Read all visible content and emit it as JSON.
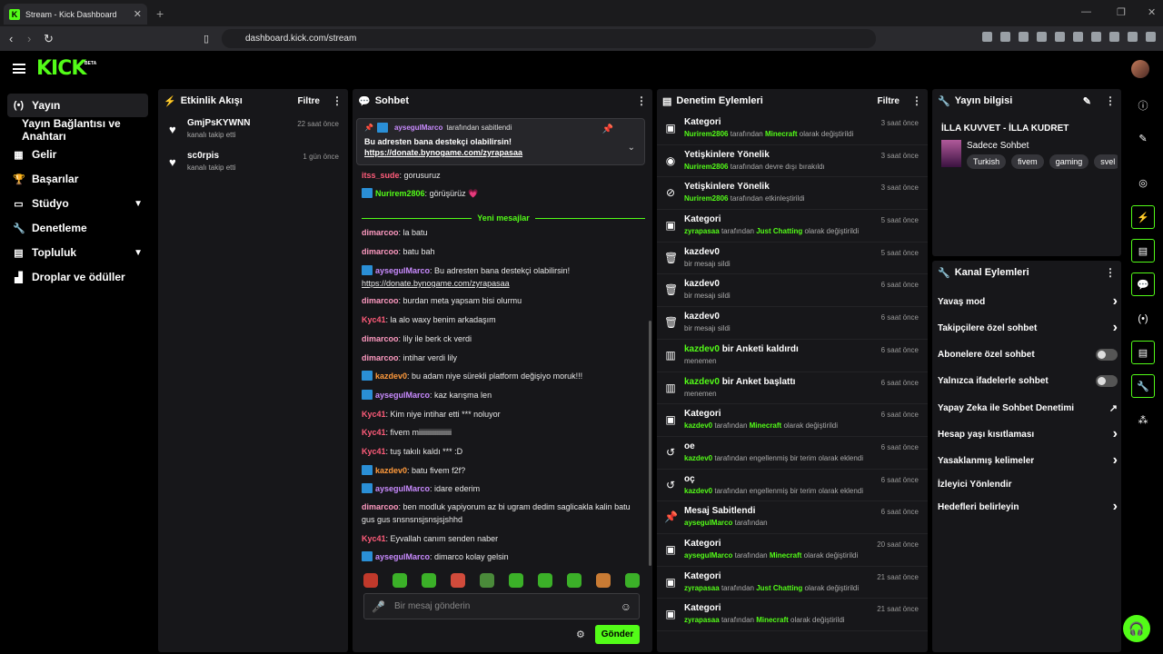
{
  "browser": {
    "tab_title": "Stream - Kick Dashboard",
    "url": "dashboard.kick.com/stream"
  },
  "header": {
    "logo": "KICK",
    "beta": "BETA"
  },
  "sidebar": {
    "items": [
      {
        "label": "Yayın",
        "icon": "broadcast-icon"
      },
      {
        "label": "Yayın Bağlantısı ve Anahtarı",
        "icon": ""
      },
      {
        "label": "Gelir",
        "icon": "grid-icon"
      },
      {
        "label": "Başarılar",
        "icon": "trophy-icon"
      },
      {
        "label": "Stüdyo",
        "icon": "studio-icon"
      },
      {
        "label": "Denetleme",
        "icon": "wrench-icon"
      },
      {
        "label": "Topluluk",
        "icon": "community-icon"
      },
      {
        "label": "Droplar ve ödüller",
        "icon": "drops-icon"
      }
    ]
  },
  "activity": {
    "title": "Etkinlik Akışı",
    "filter": "Filtre",
    "items": [
      {
        "name": "GmjPsKYWNN",
        "sub": "kanalı takip etti",
        "time": "22 saat önce"
      },
      {
        "name": "sc0rpis",
        "sub": "kanalı takip etti",
        "time": "1 gün önce"
      }
    ]
  },
  "chat": {
    "title": "Sohbet",
    "pinned": {
      "user": "aysegulMarco",
      "by": "tarafından sabitlendi",
      "message": "Bu adresten bana destekçi olabilirsin!",
      "link": "https://donate.bynogame.com/zyrapasaa"
    },
    "new_messages": "Yeni mesajlar",
    "messages": [
      {
        "user": "itss_sude",
        "color": "#ff5c7a",
        "text": "gorusuruz",
        "badge": false
      },
      {
        "user": "Nurirem2806",
        "color": "#53fc18",
        "text": "görüşürüz 💗",
        "badge": true
      },
      {
        "user": "dimarcoo",
        "color": "#ff9ac1",
        "text": "la batu",
        "badge": false
      },
      {
        "user": "dimarcoo",
        "color": "#ff9ac1",
        "text": "batu bah",
        "badge": false
      },
      {
        "user": "aysegulMarco",
        "color": "#c98bff",
        "text": "Bu adresten bana destekçi olabilirsin!",
        "link": "https://donate.bynogame.com/zyrapasaa",
        "badge": true
      },
      {
        "user": "dimarcoo",
        "color": "#ff9ac1",
        "text": "burdan meta yapsam bisi olurmu",
        "badge": false
      },
      {
        "user": "Kyc41",
        "color": "#ff5c7a",
        "text": "la alo waxy benim arkadaşım",
        "badge": false
      },
      {
        "user": "dimarcoo",
        "color": "#ff9ac1",
        "text": "lily ile berk ck verdi",
        "badge": false
      },
      {
        "user": "dimarcoo",
        "color": "#ff9ac1",
        "text": "intihar verdi lily",
        "badge": false
      },
      {
        "user": "kazdev0",
        "color": "#ff9a3c",
        "text": "bu adam niye sürekli platform değişiyo moruk!!!",
        "badge": true
      },
      {
        "user": "aysegulMarco",
        "color": "#c98bff",
        "text": "kaz karışma len",
        "badge": true
      },
      {
        "user": "Kyc41",
        "color": "#ff5c7a",
        "text": "Kim niye intihar etti *** noluyor",
        "badge": false
      },
      {
        "user": "Kyc41",
        "color": "#ff5c7a",
        "text": "fivem miiiiiiiiiiiiiiiiii",
        "badge": false
      },
      {
        "user": "Kyc41",
        "color": "#ff5c7a",
        "text": "tuş takılı kaldı *** :D",
        "badge": false
      },
      {
        "user": "kazdev0",
        "color": "#ff9a3c",
        "text": "batu fivem f2f?",
        "badge": true
      },
      {
        "user": "aysegulMarco",
        "color": "#c98bff",
        "text": "idare ederim",
        "badge": true
      },
      {
        "user": "dimarcoo",
        "color": "#ff9ac1",
        "text": "ben modluk yapiyorum az bi ugram dedim saglicakla kalin batu gus gus snsnsnsjsnsjsjshhd",
        "badge": false
      },
      {
        "user": "Kyc41",
        "color": "#ff5c7a",
        "text": "Eyvallah canım senden naber",
        "badge": false
      },
      {
        "user": "aysegulMarco",
        "color": "#c98bff",
        "text": "dimarco kolay gelsin",
        "badge": true
      }
    ],
    "input_placeholder": "Bir mesaj gönderin",
    "send": "Gönder"
  },
  "moderation": {
    "title": "Denetim Eylemleri",
    "filter": "Filtre",
    "items": [
      {
        "icon": "category-icon",
        "title": "Kategori",
        "by": "Nurirem2806",
        "mid": "tarafından",
        "val": "Minecraft",
        "end": "olarak değiştirildi",
        "time": "3 saat önce"
      },
      {
        "icon": "eye-icon",
        "title": "Yetişkinlere Yönelik",
        "by": "Nurirem2806",
        "mid": "tarafından devre dışı bırakıldı",
        "val": "",
        "end": "",
        "time": "3 saat önce"
      },
      {
        "icon": "eye-off-icon",
        "title": "Yetişkinlere Yönelik",
        "by": "Nurirem2806",
        "mid": "tarafından etkinleştirildi",
        "val": "",
        "end": "",
        "time": "3 saat önce"
      },
      {
        "icon": "category-icon",
        "title": "Kategori",
        "by": "zyrapasaa",
        "mid": "tarafından",
        "val": "Just Chatting",
        "end": "olarak değiştirildi",
        "time": "5 saat önce"
      },
      {
        "icon": "trash-icon",
        "title": "kazdev0",
        "by": "",
        "mid": "bir mesajı sildi",
        "val": "",
        "end": "",
        "time": "5 saat önce"
      },
      {
        "icon": "trash-icon",
        "title": "kazdev0",
        "by": "",
        "mid": "bir mesajı sildi",
        "val": "",
        "end": "",
        "time": "6 saat önce"
      },
      {
        "icon": "trash-icon",
        "title": "kazdev0",
        "by": "",
        "mid": "bir mesajı sildi",
        "val": "",
        "end": "",
        "time": "6 saat önce"
      },
      {
        "icon": "poll-icon",
        "title_g": "kazdev0",
        "title": "bir Anketi kaldırdı",
        "by": "",
        "mid": "menemen",
        "val": "",
        "end": "",
        "time": "6 saat önce"
      },
      {
        "icon": "poll-icon",
        "title_g": "kazdev0",
        "title": "bir Anket başlattı",
        "by": "",
        "mid": "menemen",
        "val": "",
        "end": "",
        "time": "6 saat önce"
      },
      {
        "icon": "category-icon",
        "title": "Kategori",
        "by": "kazdev0",
        "mid": "tarafından",
        "val": "Minecraft",
        "end": "olarak değiştirildi",
        "time": "6 saat önce"
      },
      {
        "icon": "undo-icon",
        "title": "oe",
        "by": "kazdev0",
        "mid": "tarafından engellenmiş bir terim olarak eklendi",
        "val": "",
        "end": "",
        "time": "6 saat önce"
      },
      {
        "icon": "undo-icon",
        "title": "oç",
        "by": "kazdev0",
        "mid": "tarafından engellenmiş bir terim olarak eklendi",
        "val": "",
        "end": "",
        "time": "6 saat önce"
      },
      {
        "icon": "pin-icon",
        "title": "Mesaj Sabitlendi",
        "by": "aysegulMarco",
        "mid": "tarafından",
        "val": "",
        "end": "",
        "time": "6 saat önce"
      },
      {
        "icon": "category-icon",
        "title": "Kategori",
        "by": "aysegulMarco",
        "mid": "tarafından",
        "val": "Minecraft",
        "end": "olarak değiştirildi",
        "time": "20 saat önce"
      },
      {
        "icon": "category-icon",
        "title": "Kategori",
        "by": "zyrapasaa",
        "mid": "tarafından",
        "val": "Just Chatting",
        "end": "olarak değiştirildi",
        "time": "21 saat önce"
      },
      {
        "icon": "category-icon",
        "title": "Kategori",
        "by": "zyrapasaa",
        "mid": "tarafından",
        "val": "Minecraft",
        "end": "olarak değiştirildi",
        "time": "21 saat önce"
      }
    ]
  },
  "stream_info": {
    "title": "Yayın bilgisi",
    "stream_title": "İLLA KUVVET - İLLA KUDRET",
    "category": "Sadece Sohbet",
    "tags": [
      "Turkish",
      "fivem",
      "gaming",
      "svel"
    ]
  },
  "channel_actions": {
    "title": "Kanal Eylemleri",
    "items": [
      {
        "label": "Yavaş mod",
        "ctrl": "arrow"
      },
      {
        "label": "Takipçilere özel sohbet",
        "ctrl": "arrow"
      },
      {
        "label": "Abonelere özel sohbet",
        "ctrl": "toggle"
      },
      {
        "label": "Yalnızca ifadelerle sohbet",
        "ctrl": "toggle"
      },
      {
        "label": "Yapay Zeka ile Sohbet Denetimi",
        "ctrl": "external"
      },
      {
        "label": "Hesap yaşı kısıtlaması",
        "ctrl": "arrow"
      },
      {
        "label": "Yasaklanmış kelimeler",
        "ctrl": "arrow"
      },
      {
        "label": "İzleyici Yönlendir",
        "ctrl": "none"
      },
      {
        "label": "Hedefleri belirleyin",
        "ctrl": "arrow"
      }
    ]
  }
}
